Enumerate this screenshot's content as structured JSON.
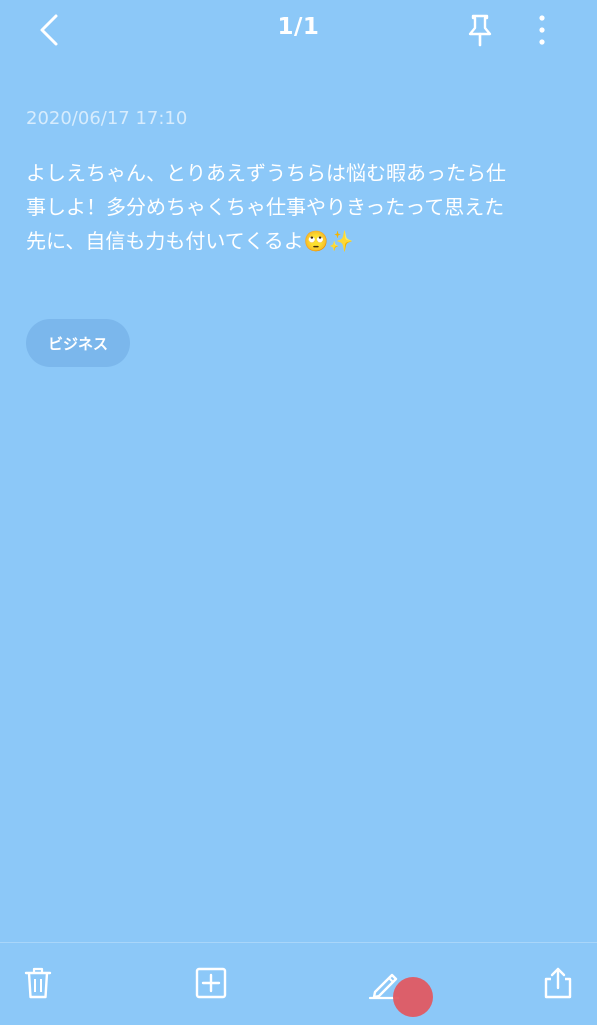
{
  "header": {
    "page_counter": "1/1",
    "back_icon": "chevron-left-icon",
    "pin_icon": "pin-icon",
    "more_icon": "vertical-ellipsis-icon"
  },
  "note": {
    "timestamp": "2020/06/17 17:10",
    "body": "よしえちゃん、とりあえずうちらは悩む暇あったら仕\n事しよ！多分めちゃくちゃ仕事やりきったって思えた\n先に、自信も力も付いてくるよ🙄✨",
    "tag": "ビジネス"
  },
  "toolbar": {
    "trash_icon": "trash-icon",
    "add_icon": "add-square-icon",
    "edit_icon": "pencil-icon",
    "share_icon": "share-icon"
  },
  "colors": {
    "background": "#8CC8F8",
    "text": "#FFFFFF",
    "touch_indicator": "#E05A62"
  }
}
